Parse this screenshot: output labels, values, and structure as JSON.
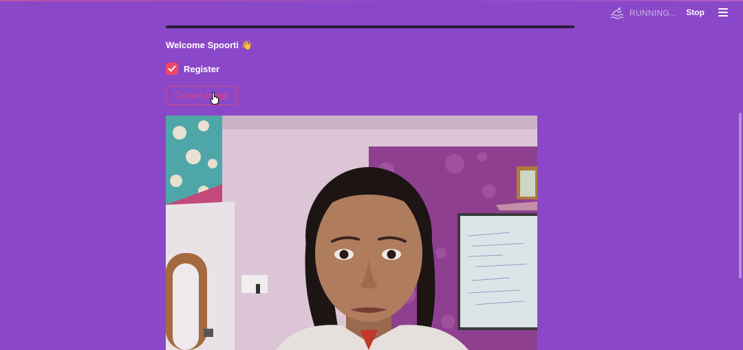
{
  "header": {
    "status_text": "RUNNING...",
    "stop_label": "Stop",
    "status_icon": "swimmer-icon",
    "menu_icon": "hamburger-menu-icon"
  },
  "main": {
    "welcome_text": "Welcome Spoorti 👋",
    "register_checkbox": {
      "label": "Register",
      "checked": true
    },
    "capture_button_label": "Capture Image",
    "camera_feed": "webcam-photo"
  },
  "colors": {
    "background": "#8a48c8",
    "accent": "#f04668",
    "divider": "#2a1b38"
  }
}
